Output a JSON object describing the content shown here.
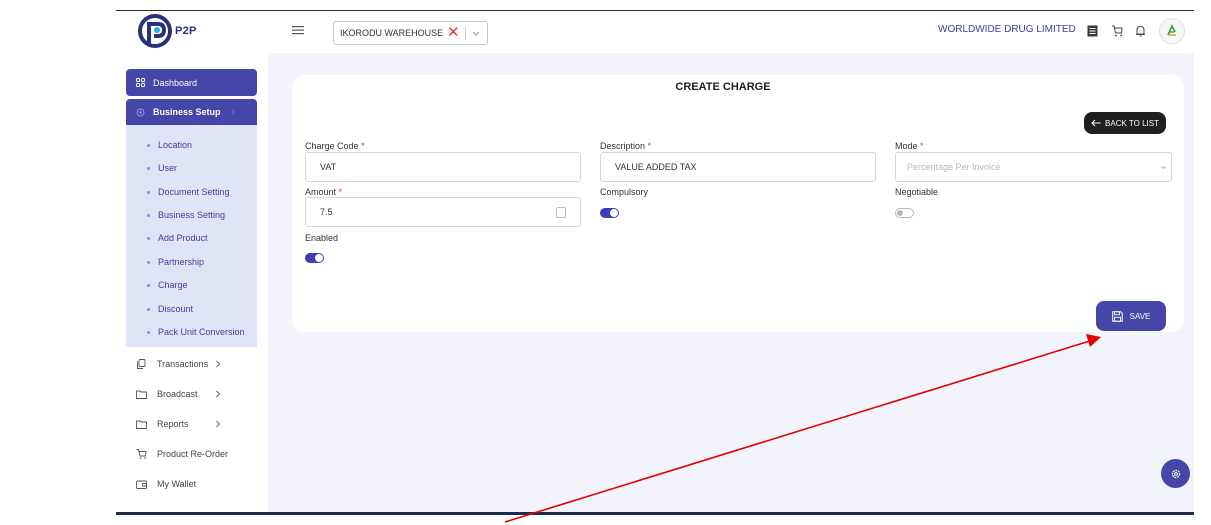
{
  "header": {
    "logo_text": "P2P",
    "warehouse": "IKORODU WAREHOUSE",
    "clear_symbol": "✕",
    "company": "WORLDWIDE DRUG LIMITED"
  },
  "sidebar": {
    "dashboard": "Dashboard",
    "business_setup": "Business Setup",
    "sub_items": [
      "Location",
      "User",
      "Document Setting",
      "Business Setting",
      "Add Product",
      "Partnership",
      "Charge",
      "Discount",
      "Pack Unit Conversion"
    ],
    "items": [
      {
        "label": "Transactions",
        "icon": "copy-icon",
        "has_arrow": true
      },
      {
        "label": "Broadcast",
        "icon": "folder-icon",
        "has_arrow": true
      },
      {
        "label": "Reports",
        "icon": "folder-icon",
        "has_arrow": true
      },
      {
        "label": "Product Re-Order",
        "icon": "cart-icon",
        "has_arrow": false
      },
      {
        "label": "My Wallet",
        "icon": "wallet-icon",
        "has_arrow": false
      }
    ]
  },
  "form": {
    "title": "CREATE CHARGE",
    "back_label": "BACK TO LIST",
    "charge_code": {
      "label": "Charge Code",
      "value": "VAT",
      "required": "*"
    },
    "description": {
      "label": "Description",
      "value": "VALUE ADDED TAX",
      "required": "*"
    },
    "mode": {
      "label": "Mode",
      "placeholder": "Percentage Per Invoice",
      "required": "*"
    },
    "amount": {
      "label": "Amount",
      "value": "7.5",
      "required": "*"
    },
    "compulsory": {
      "label": "Compulsory",
      "enabled": true
    },
    "negotiable": {
      "label": "Negotiable",
      "enabled": false
    },
    "enabled": {
      "label": "Enabled",
      "enabled": true
    },
    "save_label": "SAVE"
  },
  "colors": {
    "primary": "#4446a8",
    "submenu_bg": "#dfe4f7",
    "background": "#f3f4fb",
    "annotation": "#e30000"
  }
}
